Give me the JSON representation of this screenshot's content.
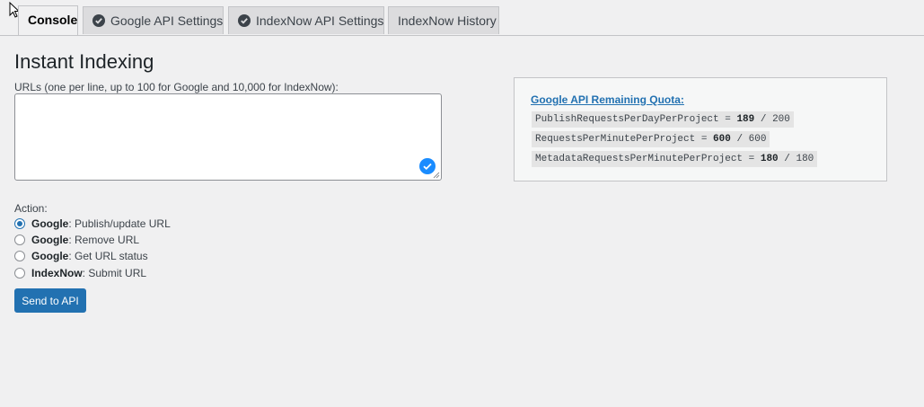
{
  "tabs": [
    {
      "label": "Console",
      "active": true,
      "checked": false
    },
    {
      "label": "Google API Settings",
      "active": false,
      "checked": true
    },
    {
      "label": "IndexNow API Settings",
      "active": false,
      "checked": true
    },
    {
      "label": "IndexNow History",
      "active": false,
      "checked": false
    }
  ],
  "page": {
    "title": "Instant Indexing",
    "urls_label": "URLs (one per line, up to 100 for Google and 10,000 for IndexNow):",
    "urls_value": "",
    "action_label": "Action:",
    "actions": [
      {
        "provider": "Google",
        "label": ": Publish/update URL",
        "checked": true
      },
      {
        "provider": "Google",
        "label": ": Remove URL",
        "checked": false
      },
      {
        "provider": "Google",
        "label": ": Get URL status",
        "checked": false
      },
      {
        "provider": "IndexNow",
        "label": ": Submit URL",
        "checked": false
      }
    ],
    "submit_label": "Send to API"
  },
  "quota": {
    "title": "Google API Remaining Quota:",
    "lines": [
      {
        "name": "PublishRequestsPerDayPerProject",
        "eq": " = ",
        "remaining": "189",
        "sep": " / ",
        "limit": "200"
      },
      {
        "name": "RequestsPerMinutePerProject",
        "eq": " = ",
        "remaining": "600",
        "sep": " / ",
        "limit": "600"
      },
      {
        "name": "MetadataRequestsPerMinutePerProject",
        "eq": " = ",
        "remaining": "180",
        "sep": " / ",
        "limit": "180"
      }
    ]
  },
  "colors": {
    "accent": "#2271b1",
    "background": "#f0f0f1",
    "grammarly": "#1a8cff"
  },
  "icons": {
    "tab_check": "check-circle-icon",
    "textarea_helper": "grammarly-check-icon",
    "cursor": "mouse-pointer-icon"
  }
}
